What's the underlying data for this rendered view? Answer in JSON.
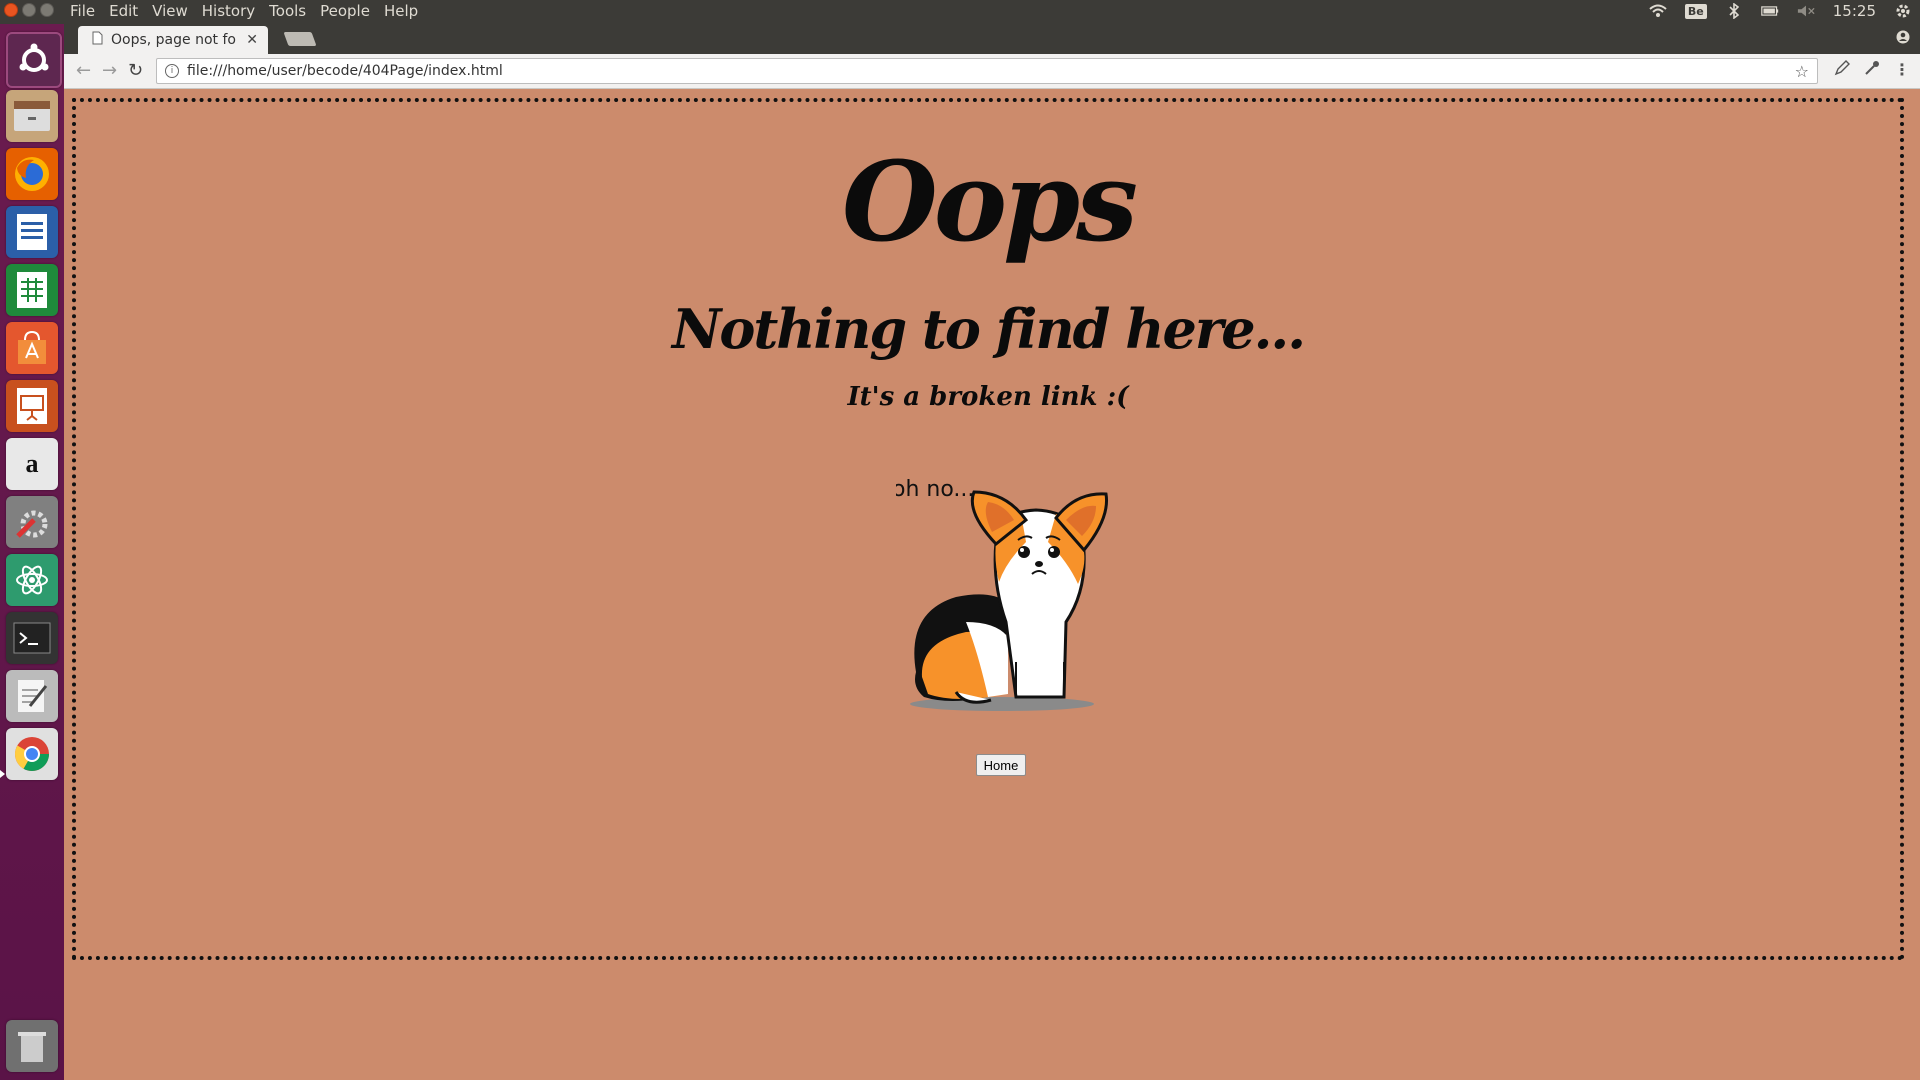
{
  "menu": [
    "File",
    "Edit",
    "View",
    "History",
    "Tools",
    "People",
    "Help"
  ],
  "tray": {
    "keyboard": "Be",
    "clock": "15:25"
  },
  "launcher": {
    "items": [
      "ubuntu-dash",
      "files",
      "firefox",
      "writer",
      "calc",
      "software-center",
      "impress",
      "amazon",
      "system-settings",
      "atom",
      "terminal",
      "text-editor",
      "chrome",
      "trash"
    ],
    "amazon_glyph": "a"
  },
  "browser": {
    "tab_title": "Oops, page not fou",
    "url": "file:///home/user/becode/404Page/index.html"
  },
  "page": {
    "title": "Oops",
    "subtitle": "Nothing to find here...",
    "message": "It's a broken link :(",
    "image_caption": "oh no...",
    "home_button": "Home",
    "background_color": "#cc8b6c"
  }
}
